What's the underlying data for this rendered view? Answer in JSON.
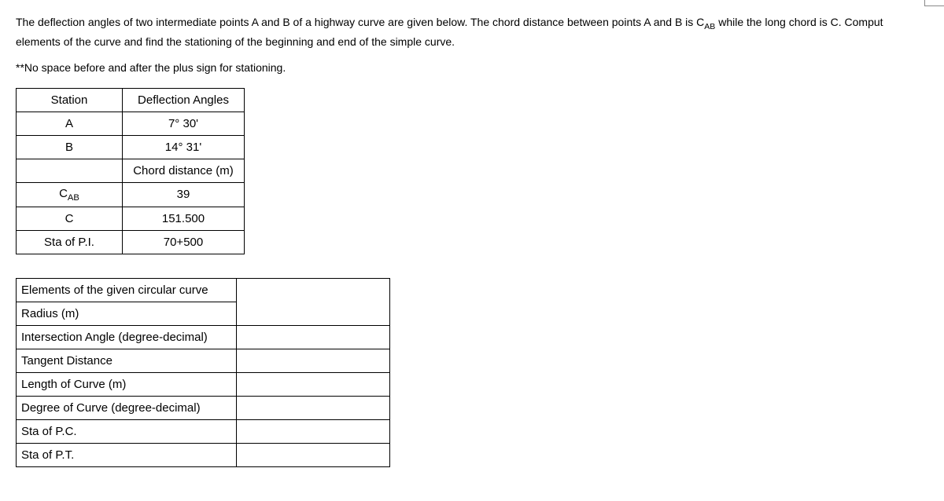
{
  "problem": {
    "line1": "The deflection angles of two intermediate points A and B of a highway curve are given below. The chord distance between points A and B is C",
    "subAB": "AB",
    "line1_cont": " while the long chord is C. Comput",
    "line2": "elements of the curve and find the stationing of the beginning and end of the simple curve.",
    "note": "**No space before and after the plus sign for stationing."
  },
  "data_table": {
    "headers": {
      "station": "Station",
      "deflection": "Deflection Angles"
    },
    "rows": [
      {
        "label": "A",
        "value": "7° 30'"
      },
      {
        "label": "B",
        "value": "14° 31'"
      }
    ],
    "chord_header": "Chord distance (m)",
    "chord_rows": [
      {
        "label_prefix": "C",
        "label_sub": "AB",
        "value": "39"
      },
      {
        "label": "C",
        "value": "151.500"
      },
      {
        "label": "Sta of P.I.",
        "value": "70+500"
      }
    ]
  },
  "answer_table": {
    "header": "Elements of the given circular curve",
    "rows": [
      "Radius (m)",
      "Intersection Angle (degree-decimal)",
      "Tangent Distance",
      "Length of Curve (m)",
      "Degree of Curve (degree-decimal)",
      "Sta of P.C.",
      "Sta of P.T."
    ]
  }
}
